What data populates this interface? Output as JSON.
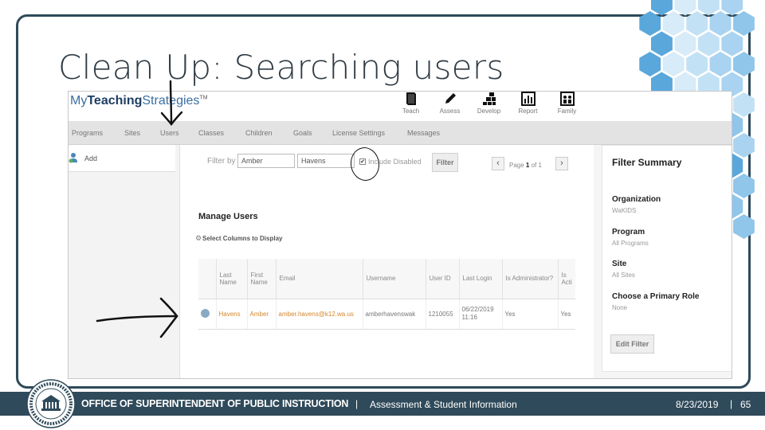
{
  "slide": {
    "title": "Clean Up: Searching users"
  },
  "brand": {
    "my": "My",
    "teaching": "Teaching",
    "strategies": "Strategies",
    "tm": "TM"
  },
  "tools": [
    {
      "label": "Teach",
      "icon": "book-icon"
    },
    {
      "label": "Assess",
      "icon": "pencil-icon"
    },
    {
      "label": "Develop",
      "icon": "blocks-icon"
    },
    {
      "label": "Report",
      "icon": "bar-chart-icon"
    },
    {
      "label": "Family",
      "icon": "family-icon"
    }
  ],
  "nav": [
    "Programs",
    "Sites",
    "Users",
    "Classes",
    "Children",
    "Goals",
    "License Settings",
    "Messages"
  ],
  "left_panel": {
    "add_label": "Add"
  },
  "filter": {
    "label": "Filter by",
    "first_value": "Amber",
    "last_value": "Havens",
    "include_disabled_label": "Include Disabled",
    "include_disabled_mark": "✔",
    "button": "Filter",
    "page_label": "Page",
    "page_current": "1",
    "page_of": "of 1",
    "prev": "‹",
    "next": "›"
  },
  "manage": {
    "title": "Manage Users",
    "select_columns": "Select Columns to Display",
    "columns": [
      "",
      "Last Name",
      "First Name",
      "Email",
      "Username",
      "User ID",
      "Last Login",
      "Is Administrator?",
      "Is Acti"
    ],
    "rows": [
      {
        "last": "Havens",
        "first": "Amber",
        "email": "amber.havens@k12.wa.us",
        "username": "amberhavenswak",
        "user_id": "1210055",
        "last_login": "06/22/2019 11:16",
        "is_admin": "Yes",
        "is_active": "Yes"
      }
    ]
  },
  "summary": {
    "title": "Filter Summary",
    "items": [
      {
        "label": "Organization",
        "value": "WaKIDS"
      },
      {
        "label": "Program",
        "value": "All Programs"
      },
      {
        "label": "Site",
        "value": "All Sites"
      },
      {
        "label": "Choose a Primary Role",
        "value": "None"
      }
    ],
    "edit_button": "Edit Filter"
  },
  "footer": {
    "org": "OFFICE OF SUPERINTENDENT OF PUBLIC INSTRUCTION",
    "separator": "|",
    "department": "Assessment & Student Information",
    "date": "8/23/2019",
    "page": "65"
  },
  "colors": {
    "footer_bg": "#2f4a5a",
    "frame_border": "#2f4a5a",
    "brand_blue": "#3a6fa3",
    "link_orange": "#d4882c",
    "hex_light": "#d7ebf8",
    "hex_mid": "#a9d3f0",
    "hex_dark": "#5aa7dc"
  }
}
